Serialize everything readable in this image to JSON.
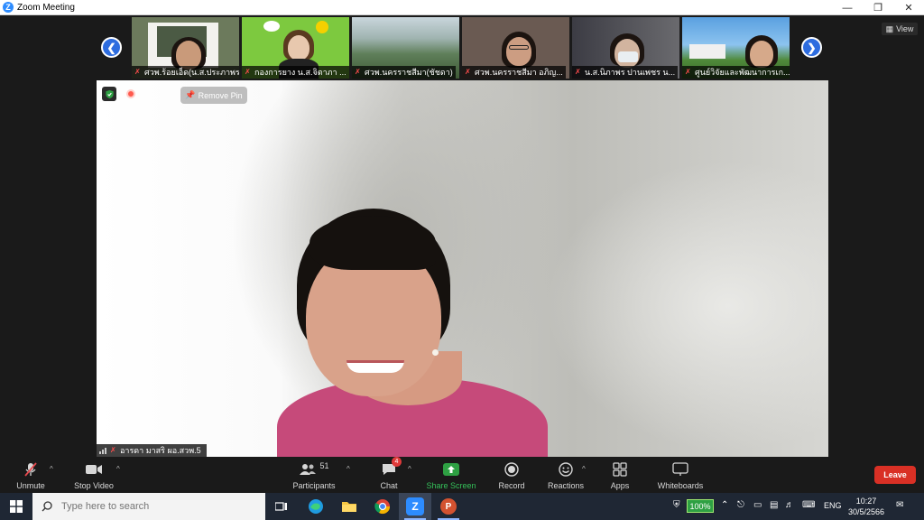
{
  "window": {
    "title": "Zoom Meeting",
    "controls": [
      "minimize",
      "restore",
      "close"
    ]
  },
  "gallery": {
    "participants": [
      {
        "name": "ศวพ.ร้อยเอ็ด(น.ส.ประภาพร)",
        "bg": "#6f7f5e"
      },
      {
        "name": "กองการยาง น.ส.จิตาภา ...",
        "bg": "#7dc93f"
      },
      {
        "name": "ศวพ.นครราชสีมา(ชัชดา)",
        "bg": "#8aa3a0"
      },
      {
        "name": "ศวพ.นครราชสีมา อภิญ...",
        "bg": "#5b4b45"
      },
      {
        "name": "น.ส.นิภาพร ปานเพชร น...",
        "bg": "#4d4d52"
      },
      {
        "name": "ศูนย์วิจัยและพัฒนาการเก...",
        "bg": "#5fa6e0"
      }
    ],
    "view_label": "View"
  },
  "main": {
    "speaker_name": "อารดา มาสริ  ผอ.สวพ.5",
    "remove_pin_label": "Remove Pin"
  },
  "toolbar": {
    "unmute": "Unmute",
    "stop_video": "Stop Video",
    "participants": "Participants",
    "participants_count": "51",
    "chat": "Chat",
    "chat_badge": "4",
    "share_screen": "Share Screen",
    "record": "Record",
    "reactions": "Reactions",
    "apps": "Apps",
    "whiteboards": "Whiteboards",
    "leave": "Leave",
    "share_color": "#2ea043",
    "leave_color": "#d93025"
  },
  "taskbar": {
    "search_placeholder": "Type here to search",
    "battery": "100%",
    "language": "ENG",
    "time": "10:27",
    "date": "30/5/2566"
  }
}
